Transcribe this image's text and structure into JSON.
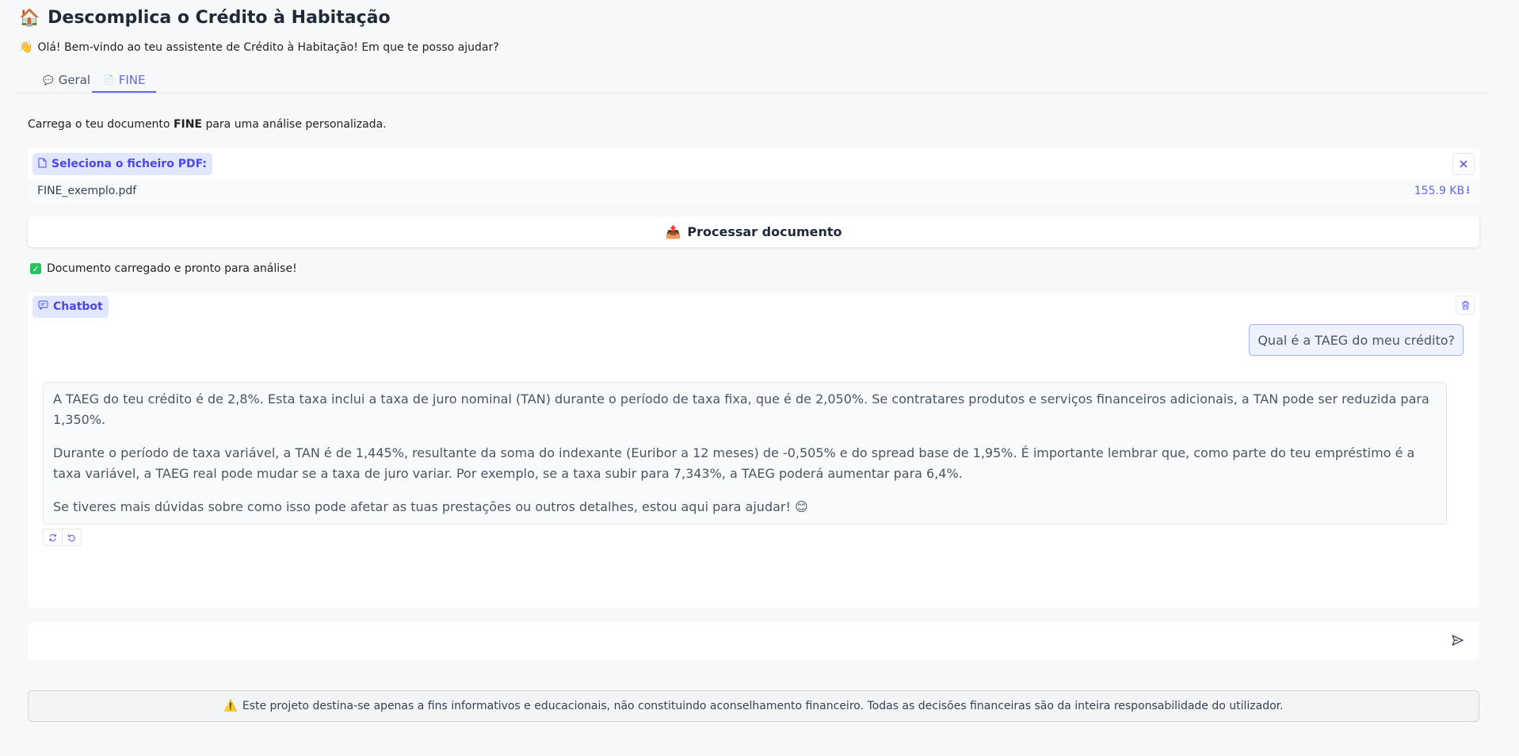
{
  "header": {
    "title_icon": "house-emoji",
    "title_emoji": "🏠",
    "title": "Descomplica o Crédito à Habitação",
    "welcome_emoji": "👋",
    "welcome": "Olá! Bem-vindo ao teu assistente de Crédito à Habitação! Em que te posso ajudar?"
  },
  "tabs": [
    {
      "label": "Geral",
      "icon": "speech-bubble-icon",
      "glyph": "💬",
      "active": false
    },
    {
      "label": "FINE",
      "icon": "document-icon",
      "glyph": "📄",
      "active": true
    }
  ],
  "intro": {
    "before": "Carrega o teu documento ",
    "bold": "FINE",
    "after": " para uma análise personalizada."
  },
  "upload": {
    "label": "Seleciona o ficheiro PDF:",
    "file_name": "FINE_exemplo.pdf",
    "file_size": "155.9 KB",
    "download_glyph": "⭳"
  },
  "process_button": {
    "emoji": "📤",
    "label": "Processar documento"
  },
  "status": {
    "check": "✓",
    "text": "Documento carregado e pronto para análise!"
  },
  "chatbot": {
    "label": "Chatbot",
    "messages": [
      {
        "role": "user",
        "text": "Qual é a TAEG do meu crédito?"
      },
      {
        "role": "assistant",
        "paragraphs": [
          "A TAEG do teu crédito é de 2,8%. Esta taxa inclui a taxa de juro nominal (TAN) durante o período de taxa fixa, que é de 2,050%. Se contratares produtos e serviços financeiros adicionais, a TAN pode ser reduzida para 1,350%.",
          "Durante o período de taxa variável, a TAN é de 1,445%, resultante da soma do indexante (Euribor a 12 meses) de -0,505% e do spread base de 1,95%. É importante lembrar que, como parte do teu empréstimo é a taxa variável, a TAEG real pode mudar se a taxa de juro variar. Por exemplo, se a taxa subir para 7,343%, a TAEG poderá aumentar para 6,4%.",
          "Se tiveres mais dúvidas sobre como isso pode afetar as tuas prestações ou outros detalhes, estou aqui para ajudar! 😊"
        ]
      }
    ]
  },
  "input": {
    "value": "",
    "placeholder": ""
  },
  "disclaimer": {
    "emoji": "⚠️",
    "text": "Este projeto destina-se apenas a fins informativos e educacionais, não constituindo aconselhamento financeiro. Todas as decisões financeiras são da inteira responsabilidade do utilizador."
  },
  "colors": {
    "accent": "#6366f1",
    "label_bg": "#e0e7ff",
    "page_bg": "#f7f8fa",
    "success": "#22c55e"
  }
}
